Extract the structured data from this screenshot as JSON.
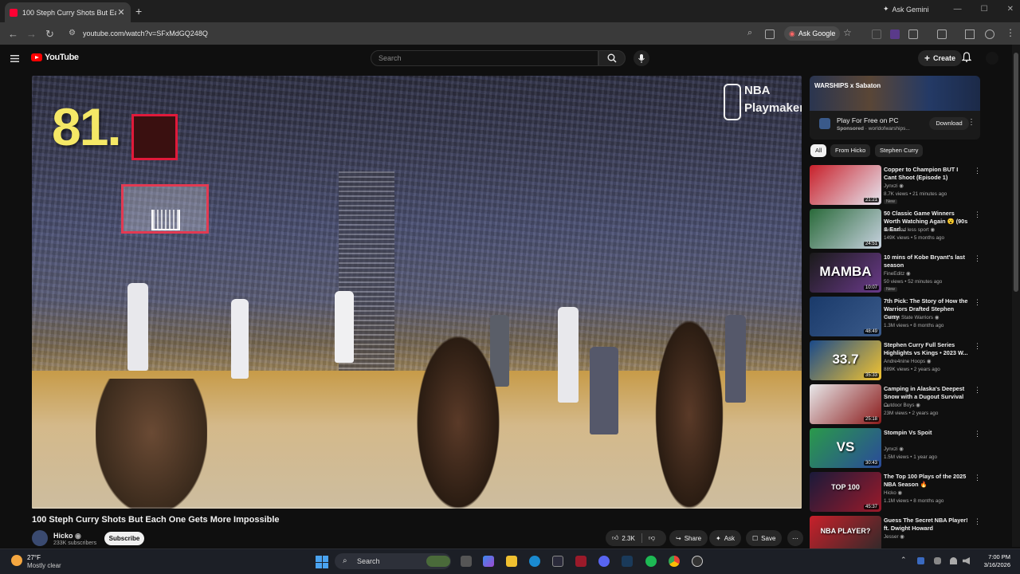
{
  "browser": {
    "tab_title": "100 Steph Curry Shots But Each One Gets More Impossible",
    "url": "youtube.com/watch?v=SFxMdGQ248Q",
    "ask_google": "Ask Google",
    "ask_gemini": "Ask Gemini"
  },
  "youtube": {
    "logo_text": "YouTube",
    "search_placeholder": "Search",
    "create_label": "Create"
  },
  "video": {
    "counter": "81.",
    "watermark_line1": "NBA",
    "watermark_line2": "Playmakers",
    "progress": 0.0,
    "title": "100 Steph Curry Shots But Each One Gets More Impossible",
    "channel": "Hicko",
    "subscribers": "233K subscribers",
    "subscribe_label": "Subscribe",
    "likes": "2.3K",
    "share_label": "Share",
    "ask_label": "Ask",
    "save_label": "Save"
  },
  "ad": {
    "banner_text": "WARSHIPS x Sabaton",
    "title": "Play For Free on PC",
    "sponsored": "Sponsored",
    "advertiser": "worldofwarships...",
    "button": "Download"
  },
  "chips": [
    "All",
    "From Hicko",
    "Stephen Curry"
  ],
  "recommendations": [
    {
      "title": "Copper to Champion BUT I Cant Shoot (Episode 1)",
      "channel": "Jynxzi",
      "meta": "8.7K views • 21 minutes ago",
      "badge": "New",
      "duration": "21:21",
      "colors": [
        "#c8202a",
        "#e6e6f0"
      ]
    },
    {
      "title": "50 Classic Game Winners Worth Watching Again 😮 (90s & Earl...",
      "channel": "Hicko",
      "channel_extra": "and less sport",
      "meta": "149K views • 5 months ago",
      "badge": "",
      "duration": "24:51",
      "colors": [
        "#2a6a3a",
        "#c8d2e0"
      ]
    },
    {
      "title": "10 mins of Kobe Bryant's last season",
      "channel": "FineEditz",
      "meta": "50 views • 52 minutes ago",
      "badge": "New",
      "duration": "10:07",
      "thumb_text": "MAMBA",
      "colors": [
        "#1a1a1a",
        "#6a3a8a"
      ]
    },
    {
      "title": "7th Pick: The Story of How the Warriors Drafted Stephen Curry",
      "channel": "Golden State Warriors",
      "meta": "1.3M views • 8 months ago",
      "badge": "",
      "duration": "48:49",
      "colors": [
        "#1a3a6a",
        "#3a5a8a"
      ]
    },
    {
      "title": "Stephen Curry Full Series Highlights vs Kings • 2023 W...",
      "channel": "Andre4nine Hoops",
      "meta": "889K views • 2 years ago",
      "badge": "",
      "duration": "35:33",
      "thumb_text": "33.7",
      "colors": [
        "#1a4a8a",
        "#f4c430"
      ]
    },
    {
      "title": "Camping in Alaska's Deepest Snow with a Dugout Survival ...",
      "channel": "Outdoor Boys",
      "meta": "23M views • 2 years ago",
      "badge": "",
      "duration": "25:18",
      "colors": [
        "#e8e8ea",
        "#8a1a1a"
      ]
    },
    {
      "title": "Stompin Vs Spoit",
      "channel": "Jynxzi",
      "meta": "1.5M views • 1 year ago",
      "badge": "",
      "duration": "30:43",
      "thumb_text": "VS",
      "colors": [
        "#2a9a4a",
        "#2a4a9a"
      ]
    },
    {
      "title": "The Top 100 Plays of the 2025 NBA Season 🔥",
      "channel": "Hicko",
      "meta": "1.1M views • 8 months ago",
      "badge": "",
      "duration": "45:37",
      "thumb_text": "TOP 100",
      "colors": [
        "#1a1a3a",
        "#9a1a2a"
      ]
    },
    {
      "title": "Guess The Secret NBA Player! ft. Dwight Howard",
      "channel": "Jesser",
      "meta": "",
      "badge": "",
      "duration": "",
      "thumb_text": "NBA PLAYER?",
      "colors": [
        "#c8202a",
        "#2a2a2a"
      ]
    }
  ],
  "taskbar": {
    "temperature": "27°F",
    "weather": "Mostly clear",
    "search": "Search",
    "time": "7:00 PM",
    "date": "3/16/2026"
  }
}
